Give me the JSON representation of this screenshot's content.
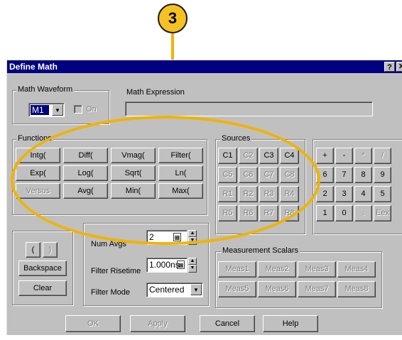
{
  "callout": {
    "number": "3"
  },
  "window": {
    "title": "Define Math",
    "help_label": "?",
    "close_label": "✕"
  },
  "math_waveform": {
    "group_label": "Math Waveform",
    "selected": "M1",
    "on_label": "On"
  },
  "math_expression": {
    "label": "Math Expression",
    "value": ""
  },
  "functions": {
    "group_label": "Functions",
    "buttons": [
      "Intg(",
      "Diff(",
      "Vmag(",
      "Filter(",
      "Exp(",
      "Log(",
      "Sqrt(",
      "Ln(",
      "Versus",
      "Avg(",
      "Min(",
      "Max("
    ]
  },
  "sources": {
    "group_label": "Sources",
    "buttons": [
      "C1",
      "C2",
      "C3",
      "C4",
      "C5",
      "C6",
      "C7",
      "C8",
      "R1",
      "R2",
      "R3",
      "R4",
      "R5",
      "R6",
      "R7",
      "R8"
    ]
  },
  "keypad": {
    "buttons": [
      "+",
      "-",
      "*",
      "/",
      "6",
      "7",
      "8",
      "9",
      "2",
      "3",
      "4",
      "5",
      "1",
      "0",
      ".",
      "Eex"
    ]
  },
  "editing": {
    "open_paren": "(",
    "close_paren": ")",
    "backspace": "Backspace",
    "clear": "Clear"
  },
  "averages": {
    "label": "Num Avgs",
    "value": "2"
  },
  "filter_risetime": {
    "label": "Filter Risetime",
    "value": "1.000ns"
  },
  "filter_mode": {
    "label": "Filter Mode",
    "value": "Centered"
  },
  "measurement_scalars": {
    "group_label": "Measurement Scalars",
    "buttons": [
      "Meas1",
      "Meas2",
      "Meas3",
      "Meas4",
      "Meas5",
      "Meas6",
      "Meas7",
      "Meas8"
    ]
  },
  "footer": {
    "ok": "OK",
    "apply": "Apply",
    "cancel": "Cancel",
    "help": "Help"
  },
  "colors": {
    "highlight": "#f0b300",
    "callout_fill": "#f6c223",
    "titlebar": "#000080"
  }
}
